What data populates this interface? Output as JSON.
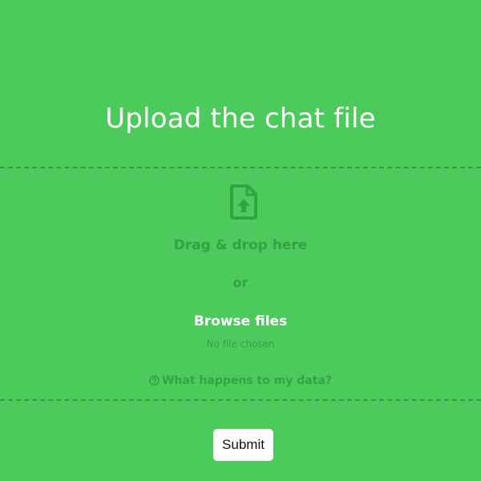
{
  "page": {
    "title": "Upload the chat file"
  },
  "dropzone": {
    "icon": "file-upload-icon",
    "drag_text": "Drag & drop here",
    "or_text": "or",
    "browse_label": "Browse files",
    "file_status": "No file chosen",
    "help_icon": "question-circle-icon",
    "privacy_link": "What happens to my data?"
  },
  "actions": {
    "submit_label": "Submit"
  },
  "colors": {
    "background": "#4ccb5c",
    "muted_green": "#31a440",
    "dashed_border": "#2f9e3d",
    "white": "#ffffff"
  }
}
